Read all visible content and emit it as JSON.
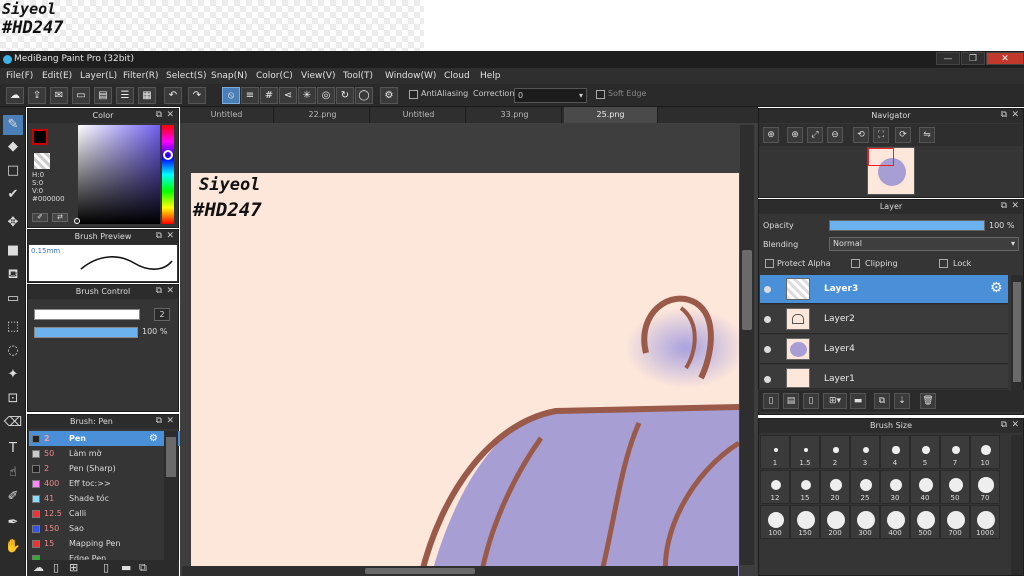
{
  "preview_strip": {
    "line1": "Siyeol",
    "line2": "#HD247"
  },
  "window": {
    "title": "MediBang Paint Pro (32bit)",
    "btn_min": "—",
    "btn_max": "❐",
    "btn_close": "✕"
  },
  "menu": [
    "File(F)",
    "Edit(E)",
    "Layer(L)",
    "Filter(R)",
    "Select(S)",
    "Snap(N)",
    "Color(C)",
    "View(V)",
    "Tool(T)",
    "Window(W)",
    "Cloud",
    "Help"
  ],
  "toolbar": {
    "antialias_label": "AntiAliasing",
    "correction_label": "Correction",
    "correction_value": "0",
    "softedge_label": "Soft Edge"
  },
  "tabs": [
    "Untitled",
    "22.png",
    "Untitled",
    "33.png",
    "25.png"
  ],
  "color_panel": {
    "title": "Color",
    "h": "H:0",
    "s": "S:0",
    "v": "V:0",
    "hex": "#000000"
  },
  "brush_preview": {
    "title": "Brush Preview",
    "size": "0.15mm"
  },
  "brush_control": {
    "title": "Brush Control",
    "size": "2",
    "opacity": "100 %"
  },
  "brush_list": {
    "title": "Brush: Pen",
    "items": [
      {
        "size": "2",
        "name": "Pen",
        "color": "#222222"
      },
      {
        "size": "50",
        "name": "Làm mờ",
        "color": "#cccccc"
      },
      {
        "size": "2",
        "name": "Pen (Sharp)",
        "color": "#222222"
      },
      {
        "size": "400",
        "name": "Eff toc:>>",
        "color": "#ff88ff"
      },
      {
        "size": "41",
        "name": "Shade tóc",
        "color": "#88ddff"
      },
      {
        "size": "12.5",
        "name": "Calli",
        "color": "#ee3333"
      },
      {
        "size": "150",
        "name": "Sao",
        "color": "#3355ee"
      },
      {
        "size": "15",
        "name": "Mapping Pen",
        "color": "#ee3333"
      },
      {
        "size": "",
        "name": "Edge Pen",
        "color": "#33aa33"
      }
    ]
  },
  "canvas": {
    "line1": "Siyeol",
    "line2": "#HD247"
  },
  "navigator": {
    "title": "Navigator"
  },
  "layer_panel": {
    "title": "Layer",
    "opacity_label": "Opacity",
    "opacity_value": "100 %",
    "opacity": 1.0,
    "blending_label": "Blending",
    "blending_value": "Normal",
    "protect_alpha": "Protect Alpha",
    "clipping": "Clipping",
    "lock": "Lock",
    "layers": [
      "Layer3",
      "Layer2",
      "Layer4",
      "Layer1"
    ]
  },
  "brush_size": {
    "title": "Brush Size",
    "sizes": [
      "1",
      "1.5",
      "2",
      "3",
      "4",
      "5",
      "7",
      "10",
      "12",
      "15",
      "20",
      "25",
      "30",
      "40",
      "50",
      "70",
      "100",
      "150",
      "200",
      "300",
      "400",
      "500",
      "700",
      "1000"
    ]
  }
}
